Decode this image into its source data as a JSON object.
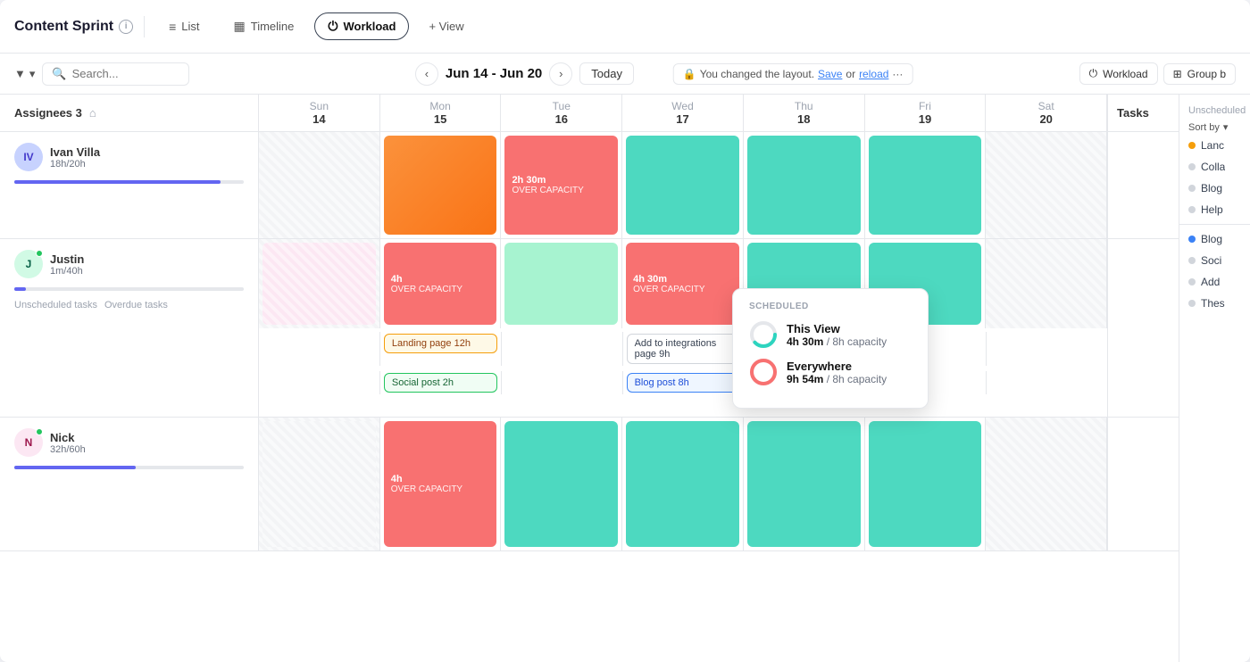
{
  "header": {
    "project_title": "Content Sprint",
    "tabs": [
      {
        "id": "list",
        "label": "List",
        "icon": "≡",
        "active": false
      },
      {
        "id": "timeline",
        "label": "Timeline",
        "icon": "▦",
        "active": false
      },
      {
        "id": "workload",
        "label": "Workload",
        "icon": "⏻",
        "active": true
      }
    ],
    "add_view_label": "+ View"
  },
  "toolbar": {
    "search_placeholder": "Search...",
    "date_range": "Jun 14 - Jun 20",
    "today_label": "Today",
    "layout_changed_message": "You changed the layout.",
    "save_label": "Save",
    "reload_label": "reload",
    "workload_label": "Workload",
    "group_label": "Group b"
  },
  "assignees_header": {
    "label": "Assignees 3"
  },
  "days": [
    {
      "name": "Sun",
      "num": "14"
    },
    {
      "name": "Mon",
      "num": "15"
    },
    {
      "name": "Tue",
      "num": "16"
    },
    {
      "name": "Wed",
      "num": "17"
    },
    {
      "name": "Thu",
      "num": "18"
    },
    {
      "name": "Fri",
      "num": "19"
    },
    {
      "name": "Sat",
      "num": "20"
    }
  ],
  "assignees": [
    {
      "id": "ivan",
      "name": "Ivan Villa",
      "hours": "18h/20h",
      "progress": 90,
      "progress_color": "#6366f1",
      "avatar_bg": "#e0e7ff",
      "avatar_text": "IV",
      "unscheduled": "",
      "overdue": ""
    },
    {
      "id": "justin",
      "name": "Justin",
      "hours": "1m/40h",
      "progress": 5,
      "progress_color": "#6366f1",
      "avatar_bg": "#d1fae5",
      "avatar_text": "J",
      "unscheduled": "Unscheduled tasks",
      "overdue": "Overdue tasks"
    },
    {
      "id": "nick",
      "name": "Nick",
      "hours": "32h/60h",
      "progress": 53,
      "progress_color": "#6366f1",
      "avatar_bg": "#fee2e2",
      "avatar_text": "N",
      "unscheduled": "",
      "overdue": ""
    }
  ],
  "tooltip": {
    "label": "SCHEDULED",
    "items": [
      {
        "title": "This View",
        "hours": "4h 30m",
        "capacity": "8h capacity",
        "fill_pct": 56
      },
      {
        "title": "Everywhere",
        "hours": "9h 54m",
        "capacity": "8h capacity",
        "fill_pct": 100
      }
    ]
  },
  "tasks_panel": {
    "header": "Tasks",
    "unscheduled_label": "Unscheduled",
    "sort_label": "Sort by",
    "items": [
      {
        "name": "Lanc",
        "color": "yellow"
      },
      {
        "name": "Colla",
        "color": "gray"
      },
      {
        "name": "Blog",
        "color": "gray"
      },
      {
        "name": "Help",
        "color": "gray"
      },
      {
        "name": "Blog",
        "color": "blue"
      },
      {
        "name": "Soci",
        "color": "gray"
      },
      {
        "name": "Add",
        "color": "gray"
      },
      {
        "name": "Thes",
        "color": "gray"
      }
    ]
  }
}
